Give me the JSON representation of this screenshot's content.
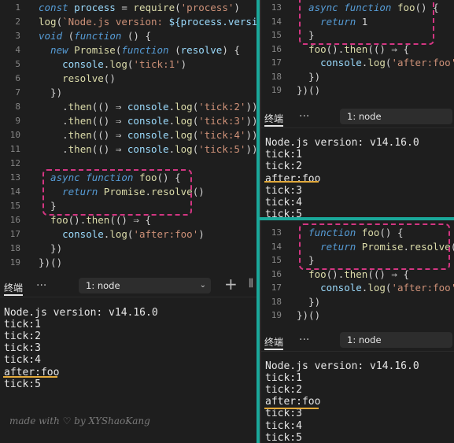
{
  "left_editor": {
    "lines": [
      {
        "n": "1",
        "segs": [
          [
            "kw",
            "const "
          ],
          [
            "var",
            "process"
          ],
          [
            "plain",
            " = "
          ],
          [
            "fn",
            "require"
          ],
          [
            "plain",
            "("
          ],
          [
            "str",
            "'process'"
          ],
          [
            "plain",
            ")"
          ]
        ]
      },
      {
        "n": "2",
        "segs": [
          [
            "fn",
            "log"
          ],
          [
            "plain",
            "("
          ],
          [
            "str",
            "`Node.js version: "
          ],
          [
            "var",
            "${process.version}"
          ],
          [
            "str",
            "`"
          ],
          [
            "plain",
            ")"
          ]
        ]
      },
      {
        "n": "3",
        "segs": [
          [
            "kw",
            "void "
          ],
          [
            "plain",
            "("
          ],
          [
            "kw",
            "function "
          ],
          [
            "plain",
            "() {"
          ]
        ]
      },
      {
        "n": "4",
        "segs": [
          [
            "kw",
            "  new "
          ],
          [
            "fn",
            "Promise"
          ],
          [
            "plain",
            "("
          ],
          [
            "kw",
            "function "
          ],
          [
            "plain",
            "("
          ],
          [
            "var",
            "resolve"
          ],
          [
            "plain",
            ") {"
          ]
        ]
      },
      {
        "n": "5",
        "segs": [
          [
            "var",
            "    console"
          ],
          [
            "plain",
            "."
          ],
          [
            "fn",
            "log"
          ],
          [
            "plain",
            "("
          ],
          [
            "str",
            "'tick:1'"
          ],
          [
            "plain",
            ")"
          ]
        ]
      },
      {
        "n": "6",
        "segs": [
          [
            "fn",
            "    resolve"
          ],
          [
            "plain",
            "()"
          ]
        ]
      },
      {
        "n": "7",
        "segs": [
          [
            "plain",
            "  })"
          ]
        ]
      },
      {
        "n": "8",
        "segs": [
          [
            "plain",
            "    ."
          ],
          [
            "fn",
            "then"
          ],
          [
            "plain",
            "(() ⇒ "
          ],
          [
            "var",
            "console"
          ],
          [
            "plain",
            "."
          ],
          [
            "fn",
            "log"
          ],
          [
            "plain",
            "("
          ],
          [
            "str",
            "'tick:2'"
          ],
          [
            "plain",
            "))"
          ]
        ]
      },
      {
        "n": "9",
        "segs": [
          [
            "plain",
            "    ."
          ],
          [
            "fn",
            "then"
          ],
          [
            "plain",
            "(() ⇒ "
          ],
          [
            "var",
            "console"
          ],
          [
            "plain",
            "."
          ],
          [
            "fn",
            "log"
          ],
          [
            "plain",
            "("
          ],
          [
            "str",
            "'tick:3'"
          ],
          [
            "plain",
            "))"
          ]
        ]
      },
      {
        "n": "10",
        "segs": [
          [
            "plain",
            "    ."
          ],
          [
            "fn",
            "then"
          ],
          [
            "plain",
            "(() ⇒ "
          ],
          [
            "var",
            "console"
          ],
          [
            "plain",
            "."
          ],
          [
            "fn",
            "log"
          ],
          [
            "plain",
            "("
          ],
          [
            "str",
            "'tick:4'"
          ],
          [
            "plain",
            "))"
          ]
        ]
      },
      {
        "n": "11",
        "segs": [
          [
            "plain",
            "    ."
          ],
          [
            "fn",
            "then"
          ],
          [
            "plain",
            "(() ⇒ "
          ],
          [
            "var",
            "console"
          ],
          [
            "plain",
            "."
          ],
          [
            "fn",
            "log"
          ],
          [
            "plain",
            "("
          ],
          [
            "str",
            "'tick:5'"
          ],
          [
            "plain",
            "))"
          ]
        ]
      },
      {
        "n": "12",
        "segs": []
      },
      {
        "n": "13",
        "segs": [
          [
            "kw",
            "  async function "
          ],
          [
            "fn",
            "foo"
          ],
          [
            "plain",
            "() {"
          ]
        ]
      },
      {
        "n": "14",
        "segs": [
          [
            "kw",
            "    return "
          ],
          [
            "fn",
            "Promise"
          ],
          [
            "plain",
            "."
          ],
          [
            "fn",
            "resolve"
          ],
          [
            "plain",
            "()"
          ]
        ]
      },
      {
        "n": "15",
        "segs": [
          [
            "plain",
            "  }"
          ]
        ]
      },
      {
        "n": "16",
        "segs": [
          [
            "fn",
            "  foo"
          ],
          [
            "plain",
            "()."
          ],
          [
            "fn",
            "then"
          ],
          [
            "plain",
            "(() ⇒ {"
          ]
        ]
      },
      {
        "n": "17",
        "segs": [
          [
            "var",
            "    console"
          ],
          [
            "plain",
            "."
          ],
          [
            "fn",
            "log"
          ],
          [
            "plain",
            "("
          ],
          [
            "str",
            "'after:foo'"
          ],
          [
            "plain",
            ")"
          ]
        ]
      },
      {
        "n": "18",
        "segs": [
          [
            "plain",
            "  })"
          ]
        ]
      },
      {
        "n": "19",
        "segs": [
          [
            "plain",
            "})()"
          ]
        ]
      }
    ]
  },
  "left_terminal": {
    "tab_label": "终端",
    "more": "···",
    "select_value": "1: node",
    "add_icon": "+",
    "lines": [
      "Node.js version: v14.16.0",
      "tick:1",
      "tick:2",
      "tick:3",
      "tick:4",
      "after:foo",
      "tick:5"
    ]
  },
  "right_top_editor": {
    "lines": [
      {
        "n": "13",
        "segs": [
          [
            "kw",
            "  async function "
          ],
          [
            "fn",
            "foo"
          ],
          [
            "plain",
            "() {"
          ]
        ]
      },
      {
        "n": "14",
        "segs": [
          [
            "kw",
            "    return "
          ],
          [
            "plain",
            "1"
          ]
        ]
      },
      {
        "n": "15",
        "segs": [
          [
            "plain",
            "  }"
          ]
        ]
      },
      {
        "n": "16",
        "segs": [
          [
            "fn",
            "  foo"
          ],
          [
            "plain",
            "()."
          ],
          [
            "fn",
            "then"
          ],
          [
            "plain",
            "(() ⇒ {"
          ]
        ]
      },
      {
        "n": "17",
        "segs": [
          [
            "var",
            "    console"
          ],
          [
            "plain",
            "."
          ],
          [
            "fn",
            "log"
          ],
          [
            "plain",
            "("
          ],
          [
            "str",
            "'after:foo'"
          ],
          [
            "plain",
            ")"
          ]
        ]
      },
      {
        "n": "18",
        "segs": [
          [
            "plain",
            "  })"
          ]
        ]
      },
      {
        "n": "19",
        "segs": [
          [
            "plain",
            "})()"
          ]
        ]
      }
    ]
  },
  "right_top_terminal": {
    "tab_label": "终端",
    "more": "···",
    "select_value": "1: node",
    "lines": [
      "Node.js version: v14.16.0",
      "tick:1",
      "tick:2",
      "after:foo",
      "tick:3",
      "tick:4",
      "tick:5"
    ]
  },
  "right_bottom_editor": {
    "lines": [
      {
        "n": "13",
        "segs": [
          [
            "kw",
            "  function "
          ],
          [
            "fn",
            "foo"
          ],
          [
            "plain",
            "() {"
          ]
        ]
      },
      {
        "n": "14",
        "segs": [
          [
            "kw",
            "    return "
          ],
          [
            "fn",
            "Promise"
          ],
          [
            "plain",
            "."
          ],
          [
            "fn",
            "resolve"
          ],
          [
            "plain",
            "()"
          ]
        ]
      },
      {
        "n": "15",
        "segs": [
          [
            "plain",
            "  }"
          ]
        ]
      },
      {
        "n": "16",
        "segs": [
          [
            "fn",
            "  foo"
          ],
          [
            "plain",
            "()."
          ],
          [
            "fn",
            "then"
          ],
          [
            "plain",
            "(() ⇒ {"
          ]
        ]
      },
      {
        "n": "17",
        "segs": [
          [
            "var",
            "    console"
          ],
          [
            "plain",
            "."
          ],
          [
            "fn",
            "log"
          ],
          [
            "plain",
            "("
          ],
          [
            "str",
            "'after:foo'"
          ],
          [
            "plain",
            ")"
          ]
        ]
      },
      {
        "n": "18",
        "segs": [
          [
            "plain",
            "  })"
          ]
        ]
      },
      {
        "n": "19",
        "segs": [
          [
            "plain",
            "})()"
          ]
        ]
      }
    ]
  },
  "right_bottom_terminal": {
    "tab_label": "终端",
    "more": "···",
    "select_value": "1: node",
    "lines": [
      "Node.js version: v14.16.0",
      "tick:1",
      "tick:2",
      "after:foo",
      "tick:3",
      "tick:4",
      "tick:5"
    ]
  },
  "watermark": "made with ♡ by XYShaoKang",
  "colors": {
    "highlight": "#d33682",
    "underline": "#e2a93b",
    "divider": "#1aa89a"
  }
}
